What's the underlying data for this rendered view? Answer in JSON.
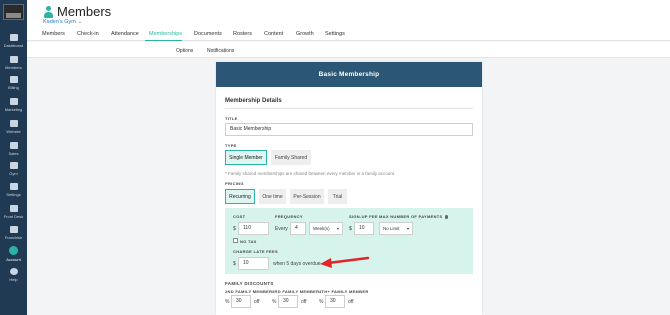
{
  "sidebar": {
    "items": [
      {
        "label": "Dashboard",
        "icon": "dashboard-icon"
      },
      {
        "label": "Members",
        "icon": "members-icon"
      },
      {
        "label": "Billing",
        "icon": "billing-icon"
      },
      {
        "label": "Marketing",
        "icon": "marketing-icon"
      },
      {
        "label": "Website",
        "icon": "website-icon"
      },
      {
        "label": "Sales",
        "icon": "sales-icon"
      },
      {
        "label": "Gym",
        "icon": "gym-icon"
      },
      {
        "label": "Settings",
        "icon": "settings-icon"
      },
      {
        "label": "Front Desk",
        "icon": "front-desk-icon"
      },
      {
        "label": "Franchise",
        "icon": "franchise-icon"
      },
      {
        "label": "Account",
        "icon": "account-icon"
      },
      {
        "label": "Help",
        "icon": "help-icon"
      }
    ],
    "active_item": "Account"
  },
  "header": {
    "title": "Members",
    "gym_name": "Kaden's Gym",
    "gym_chevron": "⌄"
  },
  "tabs": [
    "Members",
    "Check-in",
    "Attendance",
    "Memberships",
    "Documents",
    "Rosters",
    "Content",
    "Growth",
    "Settings"
  ],
  "active_tab": "Memberships",
  "subtabs": [
    "Options",
    "Notifications"
  ],
  "card": {
    "header": "Basic Membership",
    "section_title": "Membership Details",
    "title_label": "TITLE",
    "title_value": "Basic Membership",
    "type_label": "TYPE",
    "type_options": [
      "Single Member",
      "Family Shared"
    ],
    "type_selected": "Single Member",
    "type_note": "* Family shared memberships are shared between every member in a family account.",
    "pricing_label": "PRICING",
    "pricing_options": [
      "Recurring",
      "One time",
      "Per-Session",
      "Trial"
    ],
    "pricing_selected": "Recurring",
    "cost_label": "COST",
    "cost_currency": "$",
    "cost_value": "110",
    "no_tax_label": "NO TAX",
    "frequency_label": "FREQUENCY",
    "frequency_prefix": "Every",
    "frequency_value": "4",
    "frequency_unit": "Week(s)",
    "signup_label": "SIGN-UP FEE",
    "signup_currency": "$",
    "signup_value": "10",
    "max_payments_label": "MAX NUMBER OF PAYMENTS",
    "max_payments_value": "No Limit",
    "late_fee_label": "CHARGE LATE FEES",
    "late_fee_currency": "$",
    "late_fee_value": "10",
    "late_fee_suffix": "when 5 days overdue",
    "family_discounts_label": "FAMILY DISCOUNTS",
    "discounts": [
      {
        "label": "2ND FAMILY MEMBER",
        "prefix": "%",
        "value": "30",
        "suffix": "off"
      },
      {
        "label": "3RD FAMILY MEMBER",
        "prefix": "%",
        "value": "30",
        "suffix": "off"
      },
      {
        "label": "4TH+ FAMILY MEMBER",
        "prefix": "%",
        "value": "30",
        "suffix": "off"
      }
    ]
  },
  "colors": {
    "sidebar": "#1f3a52",
    "accent": "#2bb3a3",
    "card_header": "#2c5676",
    "pricing_box": "#d6f3ec",
    "annotation_arrow": "#e0262b"
  }
}
